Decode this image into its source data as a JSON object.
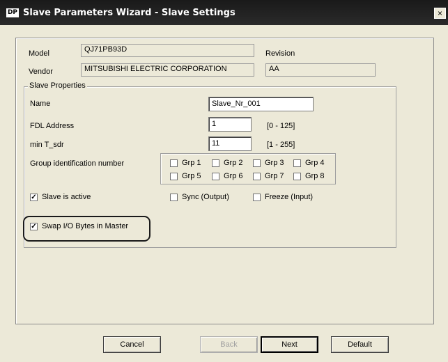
{
  "titlebar": {
    "badge": "DP",
    "title": "Slave Parameters Wizard - Slave Settings",
    "close": "×"
  },
  "identity": {
    "model_label": "Model",
    "model_value": "QJ71PB93D",
    "revision_label": "Revision",
    "vendor_label": "Vendor",
    "vendor_value": "MITSUBISHI ELECTRIC CORPORATION",
    "revision_value": "AA"
  },
  "properties": {
    "group_title": "Slave Properties",
    "name_label": "Name",
    "name_value": "Slave_Nr_001",
    "fdl_label": "FDL Address",
    "fdl_value": "1",
    "fdl_range": "[0 - 125]",
    "min_tsdr_label": "min T_sdr",
    "min_tsdr_value": "11",
    "min_tsdr_range": "[1 - 255]",
    "group_id_label": "Group identification number",
    "groups": [
      {
        "label": "Grp 1",
        "checked": false
      },
      {
        "label": "Grp 2",
        "checked": false
      },
      {
        "label": "Grp 3",
        "checked": false
      },
      {
        "label": "Grp 4",
        "checked": false
      },
      {
        "label": "Grp 5",
        "checked": false
      },
      {
        "label": "Grp 6",
        "checked": false
      },
      {
        "label": "Grp 7",
        "checked": false
      },
      {
        "label": "Grp 8",
        "checked": false
      }
    ],
    "slave_active_label": "Slave is active",
    "slave_active_checked": true,
    "sync_label": "Sync (Output)",
    "sync_checked": false,
    "freeze_label": "Freeze (Input)",
    "freeze_checked": false,
    "swap_label": "Swap I/O Bytes in Master",
    "swap_checked": true
  },
  "buttons": {
    "cancel": "Cancel",
    "back": "Back",
    "next": "Next",
    "default": "Default"
  }
}
